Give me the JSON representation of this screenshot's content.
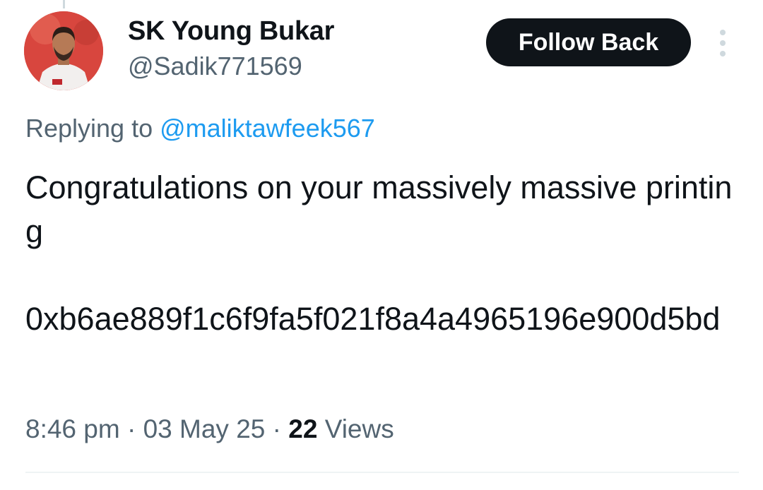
{
  "tweet": {
    "author": {
      "display_name": "SK Young Bukar",
      "handle": "@Sadik771569",
      "avatar_icon": "profile-photo"
    },
    "follow_button_label": "Follow Back",
    "more_icon": "vertical-ellipsis-icon",
    "replying_prefix": "Replying to ",
    "replying_to": "@maliktawfeek567",
    "text": "Congratulations on your massively massive printing\n\n0xb6ae889f1c6f9fa5f021f8a4a4965196e900d5bd",
    "time": "8:46 pm",
    "date": "03 May 25",
    "separator": " · ",
    "views_count": "22",
    "views_label": " Views"
  },
  "colors": {
    "text_primary": "#0f1419",
    "text_secondary": "#536471",
    "link": "#1d9bf0",
    "button_bg": "#0f1419",
    "divider": "#eff3f4"
  }
}
